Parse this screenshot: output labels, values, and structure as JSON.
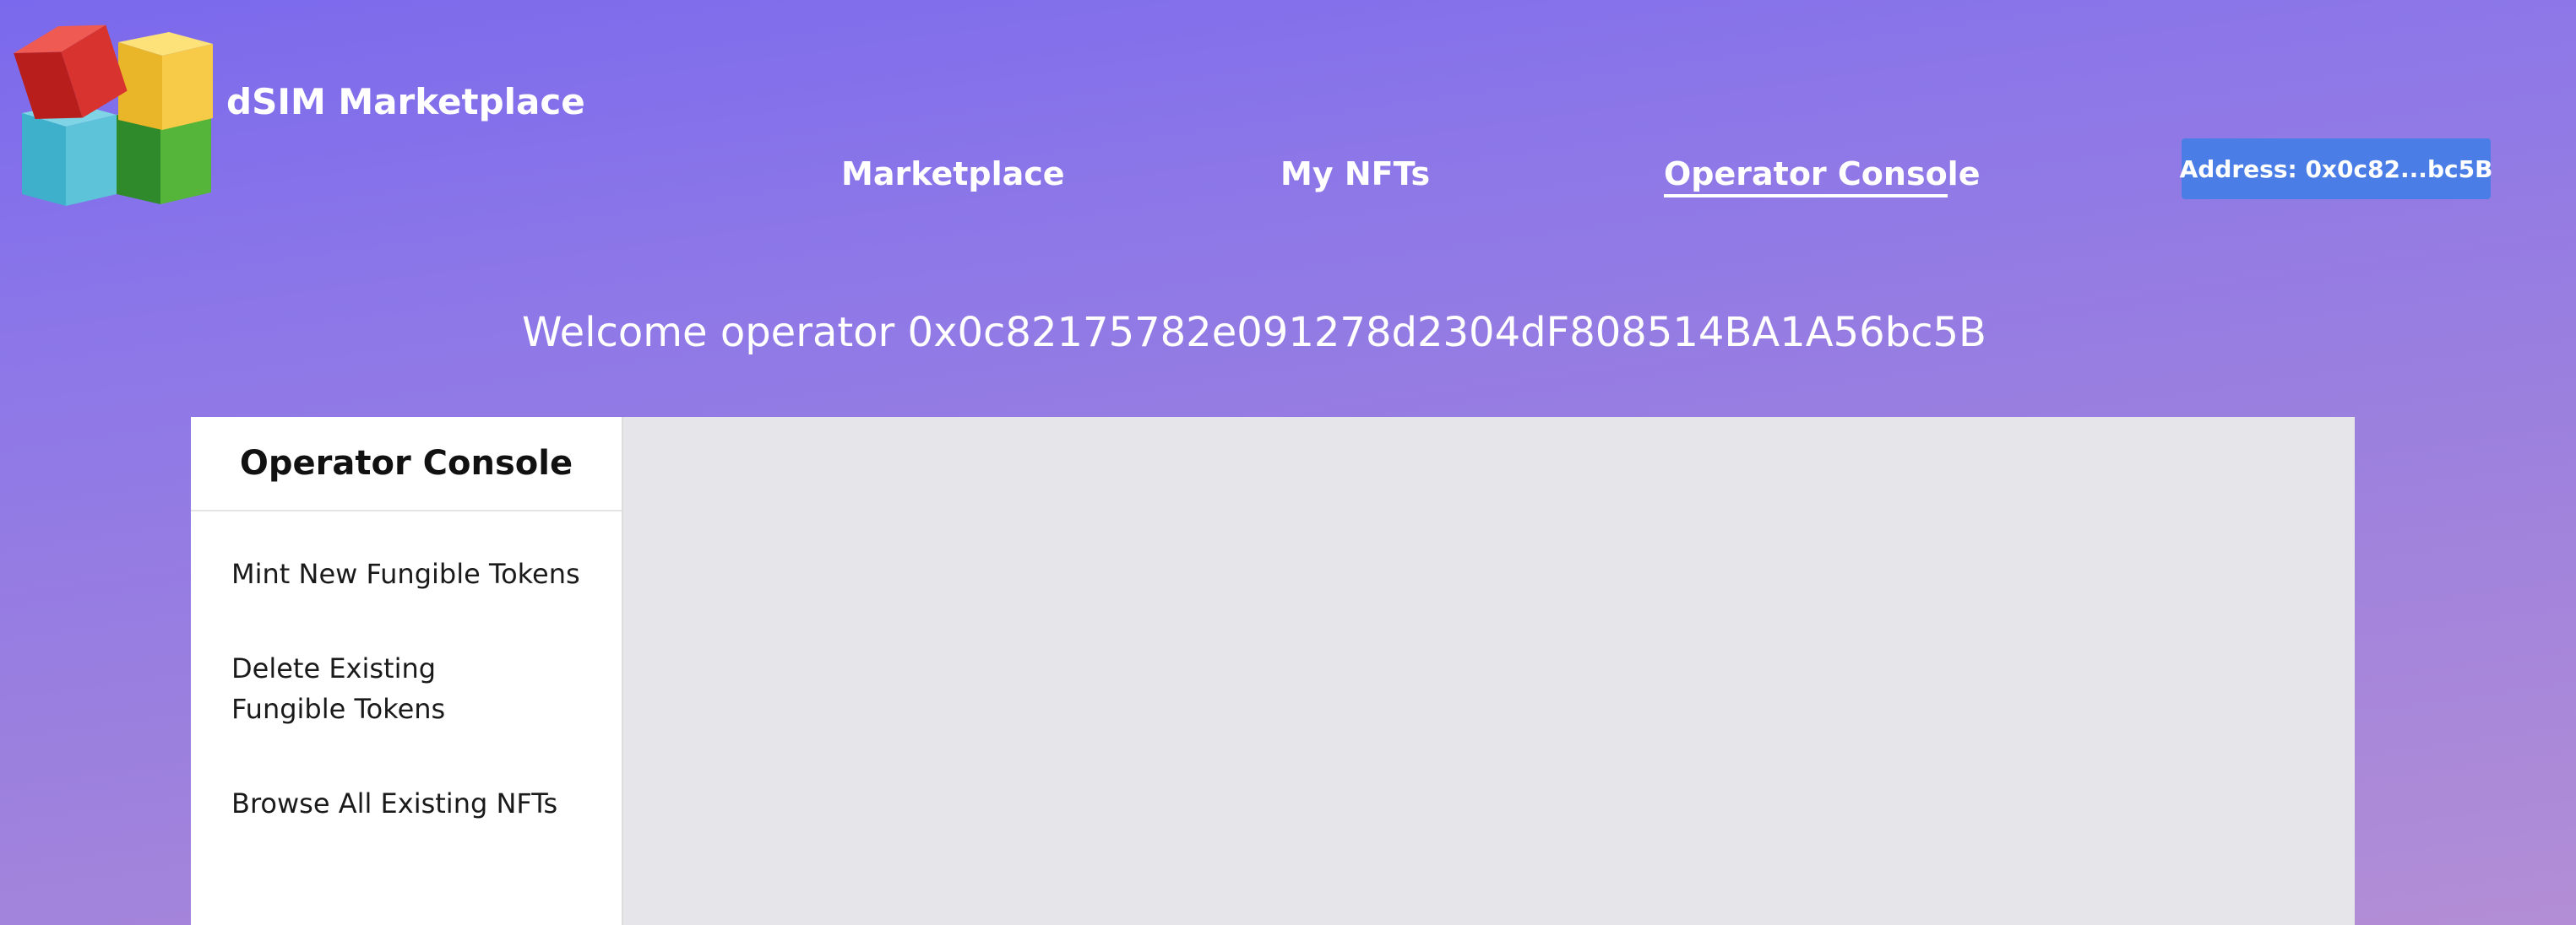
{
  "brand": {
    "name": "dSIM Marketplace",
    "logo_icon": "stacked-cubes-logo-icon"
  },
  "nav": {
    "tabs": [
      {
        "label": "Marketplace",
        "active": false
      },
      {
        "label": "My NFTs",
        "active": false
      },
      {
        "label": "Operator Console",
        "active": true
      }
    ]
  },
  "address_button": {
    "label": "Address: 0x0c82...bc5B"
  },
  "welcome": {
    "text": "Welcome operator 0x0c82175782e091278d2304dF808514BA1A56bc5B"
  },
  "console": {
    "title": "Operator Console",
    "items": [
      {
        "label": "Mint New Fungible Tokens"
      },
      {
        "label": "Delete Existing Fungible Tokens"
      },
      {
        "label": "Browse All Existing NFTs"
      }
    ]
  },
  "colors": {
    "background_top": "#7a69ec",
    "background_bottom": "#b38ed6",
    "address_button": "#4a7ee6",
    "content_area": "#e6e6ea"
  }
}
